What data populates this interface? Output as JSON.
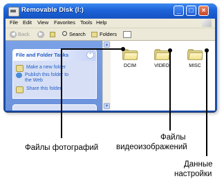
{
  "window": {
    "title": "Removable Disk (I:)",
    "controls": [
      "_",
      "□",
      "×"
    ]
  },
  "menubar": {
    "items": [
      "File",
      "Edit",
      "View",
      "Favorites",
      "Tools",
      "Help"
    ]
  },
  "toolbar": {
    "back_label": "Back",
    "search_label": "Search",
    "folders_label": "Folders",
    "forward_glyph": "▶",
    "back_glyph": "◀"
  },
  "taskpane": {
    "header": "File and Folder Tasks",
    "collapse_glyph": "⌃",
    "tasks": [
      {
        "label": "Make a new folder",
        "icon": "new-folder-icon"
      },
      {
        "label": "Publish this folder to the Web",
        "line1": "Publish this folder to",
        "line2": "the Web",
        "icon": "web-publish-icon"
      },
      {
        "label": "Share this folder",
        "icon": "share-folder-icon"
      }
    ]
  },
  "scrollbar": {
    "up_glyph": "▲",
    "down_glyph": "▼"
  },
  "folders": [
    {
      "name": "DCIM",
      "icon": "folder-icon"
    },
    {
      "name": "VIDEO",
      "icon": "folder-icon"
    },
    {
      "name": "MISC",
      "icon": "folder-icon"
    }
  ],
  "callouts": {
    "photos": "Файлы фотографий",
    "video_line1": "Файлы",
    "video_line2": "видеоизображений",
    "settings_line1": "Данные",
    "settings_line2": "настройки"
  },
  "colors": {
    "titlebar": "#1c63d8",
    "taskpane": "#7aa1e6",
    "task_link": "#215dc6",
    "folder": "#efdf8b"
  }
}
